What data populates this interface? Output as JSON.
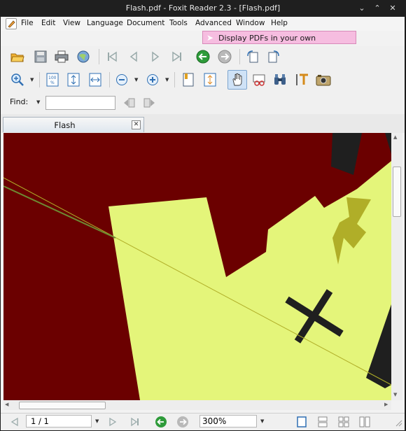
{
  "window": {
    "title": "Flash.pdf - Foxit Reader 2.3 - [Flash.pdf]"
  },
  "menu": [
    "File",
    "Edit",
    "View",
    "Language",
    "Document",
    "Tools",
    "Advanced",
    "Window",
    "Help"
  ],
  "promo": {
    "text": "Display PDFs in your own applications"
  },
  "find": {
    "label": "Find:",
    "value": ""
  },
  "tab": {
    "label": "Flash"
  },
  "status": {
    "page": "1 / 1",
    "zoom": "300%"
  },
  "colors": {
    "background": "#6b0000",
    "shape": "#e4f57a",
    "dark": "#1f1f1f",
    "accent": "#b0ae28"
  }
}
